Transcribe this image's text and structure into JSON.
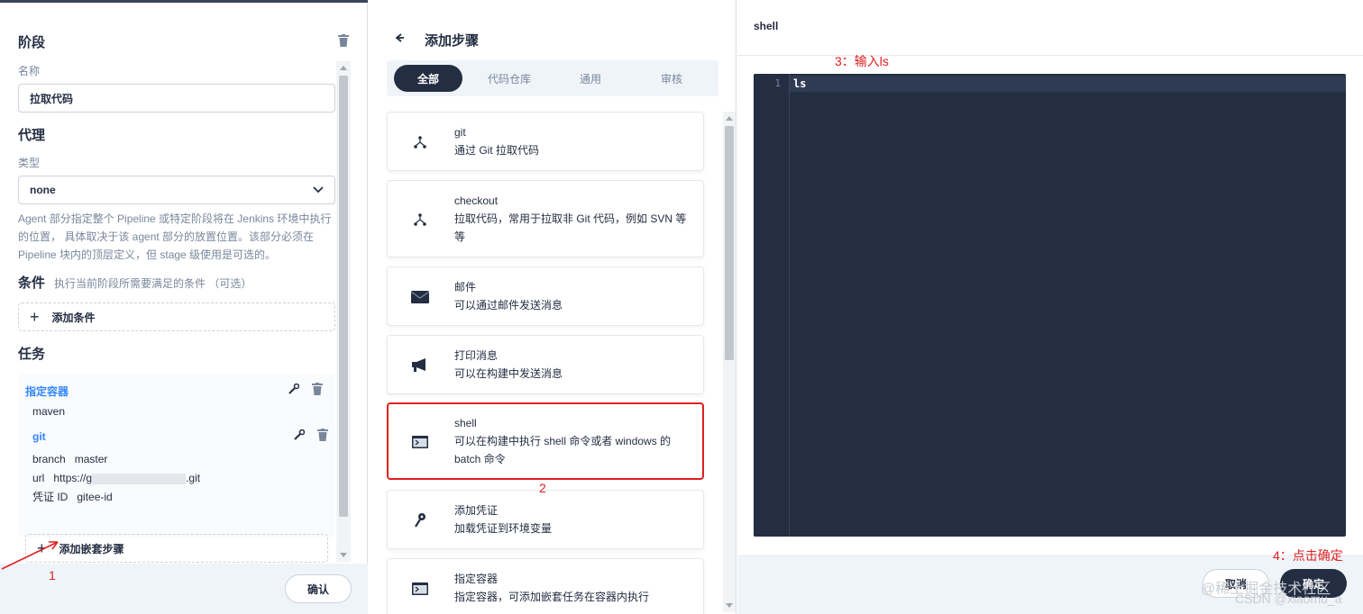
{
  "left": {
    "stage_title": "阶段",
    "name_label": "名称",
    "name_value": "拉取代码",
    "agent_title": "代理",
    "type_label": "类型",
    "type_value": "none",
    "agent_desc": "Agent 部分指定整个 Pipeline 或特定阶段将在 Jenkins 环境中执行的位置， 具体取决于该 agent 部分的放置位置。该部分必须在 Pipeline 块内的顶层定义，但 stage 级使用是可选的。",
    "condition_title": "条件",
    "condition_hint": "执行当前阶段所需要满足的条件 （可选）",
    "add_condition": "添加条件",
    "task_title": "任务",
    "container_task": "指定容器",
    "container_value": "maven",
    "git_task": "git",
    "git_branch_key": "branch",
    "git_branch_val": "master",
    "git_url_key": "url",
    "git_url_val_start": "https://g",
    "git_url_val_end": ".git",
    "git_cred_key": "凭证 ID",
    "git_cred_val": "gitee-id",
    "add_nested": "添加嵌套步骤",
    "confirm": "确认"
  },
  "mid": {
    "title": "添加步骤",
    "tabs": [
      {
        "label": "全部",
        "active": true
      },
      {
        "label": "代码仓库",
        "active": false
      },
      {
        "label": "通用",
        "active": false
      },
      {
        "label": "审核",
        "active": false
      }
    ],
    "steps": [
      {
        "name": "git",
        "desc": "通过 Git 拉取代码",
        "icon": "branch-icon"
      },
      {
        "name": "checkout",
        "desc": "拉取代码，常用于拉取非 Git 代码，例如 SVN 等等",
        "icon": "branch-icon"
      },
      {
        "name": "邮件",
        "desc": "可以通过邮件发送消息",
        "icon": "mail-icon"
      },
      {
        "name": "打印消息",
        "desc": "可以在构建中发送消息",
        "icon": "megaphone-icon"
      },
      {
        "name": "shell",
        "desc": "可以在构建中执行 shell 命令或者 windows 的 batch 命令",
        "icon": "terminal-icon"
      },
      {
        "name": "添加凭证",
        "desc": "加载凭证到环境变量",
        "icon": "key-icon"
      },
      {
        "name": "指定容器",
        "desc": "指定容器，可添加嵌套任务在容器内执行",
        "icon": "terminal-icon"
      }
    ]
  },
  "right": {
    "title": "shell",
    "line_number": "1",
    "code": "ls",
    "cancel": "取消",
    "ok": "确定"
  },
  "annotations": {
    "a1": "1",
    "a2": "2",
    "a3": "3：输入ls",
    "a4": "4：点击确定"
  },
  "watermark": {
    "line1": "@稀土掘金技术社区",
    "line2": "CSDN @xiaomu_a"
  },
  "colors": {
    "dark": "#242e42",
    "accent_blue": "#3385ff",
    "annotation_red": "#e02020",
    "muted": "#79879c"
  }
}
